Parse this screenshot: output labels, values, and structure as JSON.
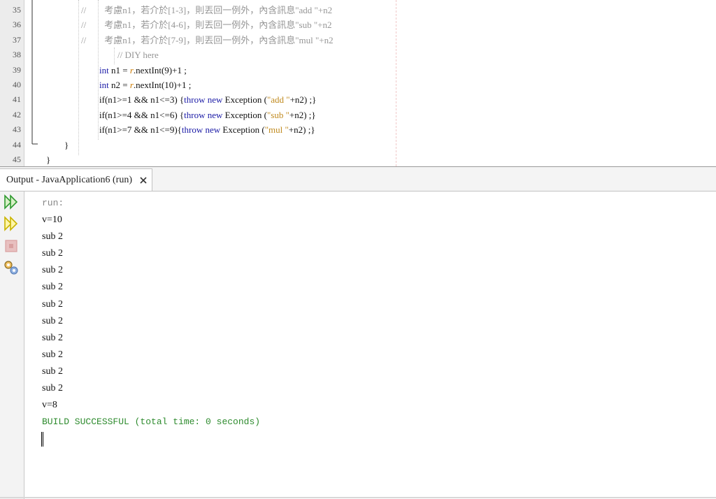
{
  "editor": {
    "lines": [
      {
        "no": "35",
        "parts": [
          {
            "t": "//",
            "c": "cm"
          },
          {
            "t": "        考慮n1，若介於[1-3]，則丟回一例外，內含訊息\"add \"+n2",
            "c": "cm"
          }
        ]
      },
      {
        "no": "36",
        "parts": [
          {
            "t": "//",
            "c": "cm"
          },
          {
            "t": "        考慮n1，若介於[4-6]，則丟回一例外，內含訊息\"sub \"+n2",
            "c": "cm"
          }
        ]
      },
      {
        "no": "37",
        "parts": [
          {
            "t": "//",
            "c": "cm"
          },
          {
            "t": "        考慮n1，若介於[7-9]，則丟回一例外，內含訊息\"mul \"+n2",
            "c": "cm"
          }
        ]
      },
      {
        "no": "38",
        "parts": [
          {
            "t": "// DIY here",
            "c": "cm"
          }
        ]
      },
      {
        "no": "39",
        "parts": [
          {
            "t": "int",
            "c": "kw"
          },
          {
            "t": " n1 = ",
            "c": ""
          },
          {
            "t": "r",
            "c": "var"
          },
          {
            "t": ".nextInt(9)+1 ;",
            "c": ""
          }
        ]
      },
      {
        "no": "40",
        "parts": [
          {
            "t": "int",
            "c": "kw"
          },
          {
            "t": " n2 = ",
            "c": ""
          },
          {
            "t": "r",
            "c": "var"
          },
          {
            "t": ".nextInt(10)+1 ;",
            "c": ""
          }
        ]
      },
      {
        "no": "41",
        "parts": [
          {
            "t": "if(n1>=1 && n1<=3) {",
            "c": ""
          },
          {
            "t": "throw",
            "c": "kw"
          },
          {
            "t": " ",
            "c": ""
          },
          {
            "t": "new",
            "c": "kw"
          },
          {
            "t": " Exception (",
            "c": ""
          },
          {
            "t": "\"add \"",
            "c": "str"
          },
          {
            "t": "+n2) ;}",
            "c": ""
          }
        ]
      },
      {
        "no": "42",
        "parts": [
          {
            "t": "if(n1>=4 && n1<=6) {",
            "c": ""
          },
          {
            "t": "throw",
            "c": "kw"
          },
          {
            "t": " ",
            "c": ""
          },
          {
            "t": "new",
            "c": "kw"
          },
          {
            "t": " Exception (",
            "c": ""
          },
          {
            "t": "\"sub \"",
            "c": "str"
          },
          {
            "t": "+n2) ;}",
            "c": ""
          }
        ]
      },
      {
        "no": "43",
        "parts": [
          {
            "t": "if(n1>=7 && n1<=9){",
            "c": ""
          },
          {
            "t": "throw",
            "c": "kw"
          },
          {
            "t": " ",
            "c": ""
          },
          {
            "t": "new",
            "c": "kw"
          },
          {
            "t": " Exception (",
            "c": ""
          },
          {
            "t": "\"mul \"",
            "c": "str"
          },
          {
            "t": "+n2) ;}",
            "c": ""
          }
        ]
      },
      {
        "no": "44",
        "parts": [
          {
            "t": "}",
            "c": ""
          }
        ]
      },
      {
        "no": "45",
        "parts": [
          {
            "t": "}",
            "c": ""
          }
        ]
      }
    ]
  },
  "output": {
    "tab_title": "Output - JavaApplication6 (run)",
    "toolbar": [
      {
        "icon": "rerun-icon",
        "color": "#2f9a2f"
      },
      {
        "icon": "rerun-with-options-icon",
        "color": "#c9b400"
      },
      {
        "icon": "stop-icon",
        "color": "#d9a0a0"
      },
      {
        "icon": "settings-icon",
        "color": "#5a7fb8"
      }
    ],
    "console": [
      {
        "text": "run:",
        "style": "dim"
      },
      {
        "text": "v=10",
        "style": ""
      },
      {
        "text": "sub 2",
        "style": ""
      },
      {
        "text": "sub 2",
        "style": ""
      },
      {
        "text": "sub 2",
        "style": ""
      },
      {
        "text": "sub 2",
        "style": ""
      },
      {
        "text": "sub 2",
        "style": ""
      },
      {
        "text": "sub 2",
        "style": ""
      },
      {
        "text": "sub 2",
        "style": ""
      },
      {
        "text": "sub 2",
        "style": ""
      },
      {
        "text": "sub 2",
        "style": ""
      },
      {
        "text": "sub 2",
        "style": ""
      },
      {
        "text": "v=8",
        "style": ""
      },
      {
        "text": "BUILD SUCCESSFUL (total time: 0 seconds)",
        "style": "ok"
      }
    ]
  }
}
